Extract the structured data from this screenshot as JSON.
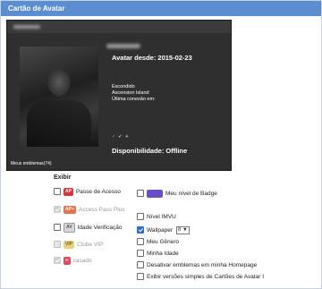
{
  "panel": {
    "title": "Cartão de Avatar"
  },
  "card": {
    "avatar_since": "Avatar desde: 2015-02-23",
    "status_lines": [
      "Escondido",
      "Ascension Island",
      "Última conexão em:"
    ],
    "icons_text": "♂ ✔ ✈",
    "availability": "Disponibilidade: Offline",
    "badges": "Meus emblemas(74)"
  },
  "options": {
    "section_label": "Exibir",
    "items": [
      {
        "label": "Passe de Acesso",
        "checked": false,
        "disabled": false
      },
      {
        "label": "Access Pass Plus",
        "checked": true,
        "disabled": true
      },
      {
        "label": "Idade Verificação",
        "checked": false,
        "disabled": false
      },
      {
        "label": "Clube VIP",
        "checked": false,
        "disabled": true
      },
      {
        "label": "casado",
        "checked": true,
        "disabled": true
      },
      {
        "label": "Meu nível de Badge",
        "checked": false,
        "disabled": false
      },
      {
        "label": "Nível IMVU",
        "checked": false,
        "disabled": false
      },
      {
        "label": "Wallpaper",
        "checked": true,
        "disabled": false,
        "select_value": "8"
      },
      {
        "label": "Meu Gênero",
        "checked": false,
        "disabled": false
      },
      {
        "label": "Minha Idade",
        "checked": false,
        "disabled": false
      },
      {
        "label": "Desativar emblemas em minha Homepage",
        "checked": false,
        "disabled": false
      },
      {
        "label": "Exibir versões simples de Cartões de Avatar I",
        "checked": false,
        "disabled": false
      }
    ],
    "icons": {
      "ap": "AP",
      "apPlus": "AP+",
      "age": "AV",
      "vip": "VIP",
      "married": "∞"
    }
  }
}
